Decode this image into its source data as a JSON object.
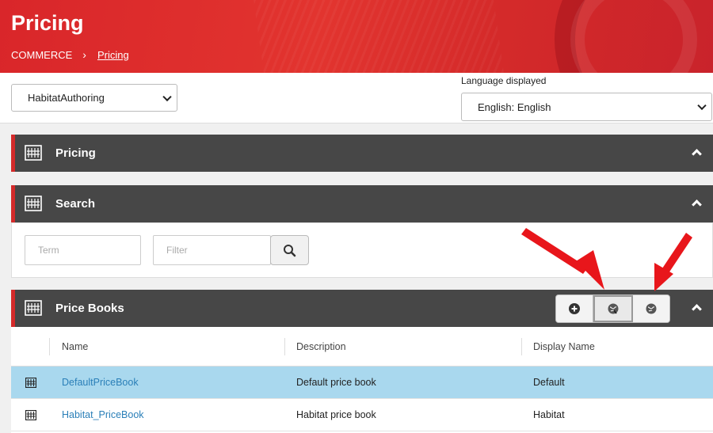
{
  "header": {
    "title": "Pricing",
    "breadcrumb": {
      "root": "COMMERCE",
      "separator": "›",
      "current": "Pricing"
    }
  },
  "toolbar": {
    "site_select_value": "HabitatAuthoring",
    "language_label": "Language displayed",
    "language_select_value": "English: English"
  },
  "panels": {
    "pricing": {
      "title": "Pricing",
      "icon": "building-icon"
    },
    "search": {
      "title": "Search",
      "icon": "building-icon",
      "term_placeholder": "Term",
      "filter_placeholder": "Filter",
      "search_button_icon": "magnifier-icon"
    },
    "price_books": {
      "title": "Price Books",
      "icon": "building-icon",
      "actions": [
        {
          "name": "add-button",
          "icon": "plus-circle-icon"
        },
        {
          "name": "localize-button",
          "icon": "globe-pin-icon"
        },
        {
          "name": "globe-button",
          "icon": "globe-icon"
        }
      ]
    }
  },
  "table": {
    "columns": [
      "Name",
      "Description",
      "Display Name"
    ],
    "rows": [
      {
        "name": "DefaultPriceBook",
        "description": "Default price book",
        "display_name": "Default",
        "selected": true
      },
      {
        "name": "Habitat_PriceBook",
        "description": "Habitat price book",
        "display_name": "Habitat",
        "selected": false
      }
    ]
  },
  "colors": {
    "header_red": "#d9262a",
    "panel_dark": "#474747",
    "accent": "#d42a2a",
    "selected_row": "#a9d8ee",
    "link": "#2a7fb8",
    "annotation_arrow": "#e8161b"
  }
}
